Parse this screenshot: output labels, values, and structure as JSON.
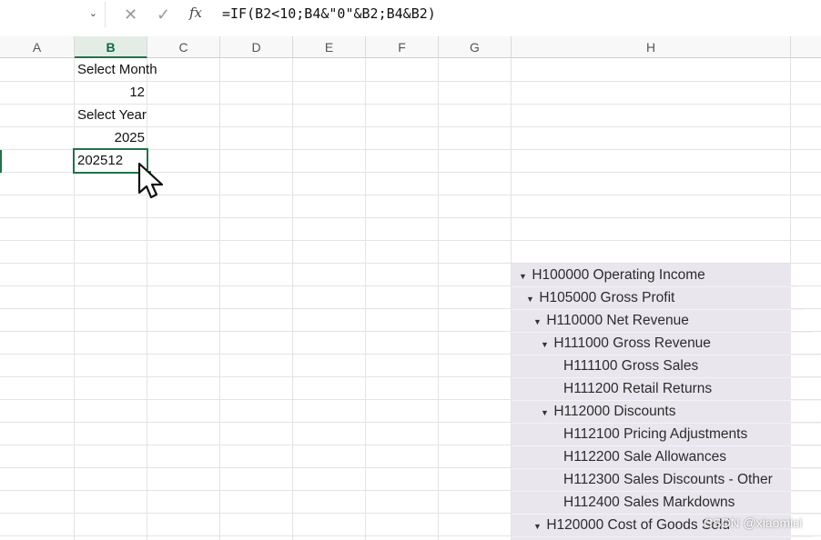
{
  "formula_bar": {
    "name_box_value": "",
    "cancel_icon": "close-icon",
    "enter_icon": "check-icon",
    "fx_label": "fx",
    "formula": "=IF(B2<10;B4&\"0\"&B2;B4&B2)"
  },
  "columns": [
    "A",
    "B",
    "C",
    "D",
    "E",
    "F",
    "G",
    "H"
  ],
  "selected_column": "B",
  "cells": {
    "b1": "Select Month",
    "b2": "12",
    "b3": "Select Year",
    "b4": "2025",
    "b5": "202512"
  },
  "pivot": {
    "rows": [
      {
        "label": "H100000 Operating Income",
        "expanded": true
      },
      {
        "label": "H105000 Gross Profit",
        "expanded": true
      },
      {
        "label": "H110000 Net Revenue",
        "expanded": true
      },
      {
        "label": "H111000 Gross Revenue",
        "expanded": true
      },
      {
        "label": "H111100 Gross Sales",
        "expanded": false
      },
      {
        "label": "H111200 Retail Returns",
        "expanded": false
      },
      {
        "label": "H112000 Discounts",
        "expanded": true
      },
      {
        "label": "H112100 Pricing Adjustments",
        "expanded": false
      },
      {
        "label": "H112200 Sale Allowances",
        "expanded": false
      },
      {
        "label": "H112300 Sales Discounts - Other",
        "expanded": false
      },
      {
        "label": "H112400 Sales Markdowns",
        "expanded": false
      },
      {
        "label": "H120000 Cost of Goods Sold",
        "expanded": true
      }
    ]
  },
  "watermark": "CSDN @xiaomici",
  "colors": {
    "accent": "#217346",
    "pivot_bg": "#e9e6ed"
  }
}
